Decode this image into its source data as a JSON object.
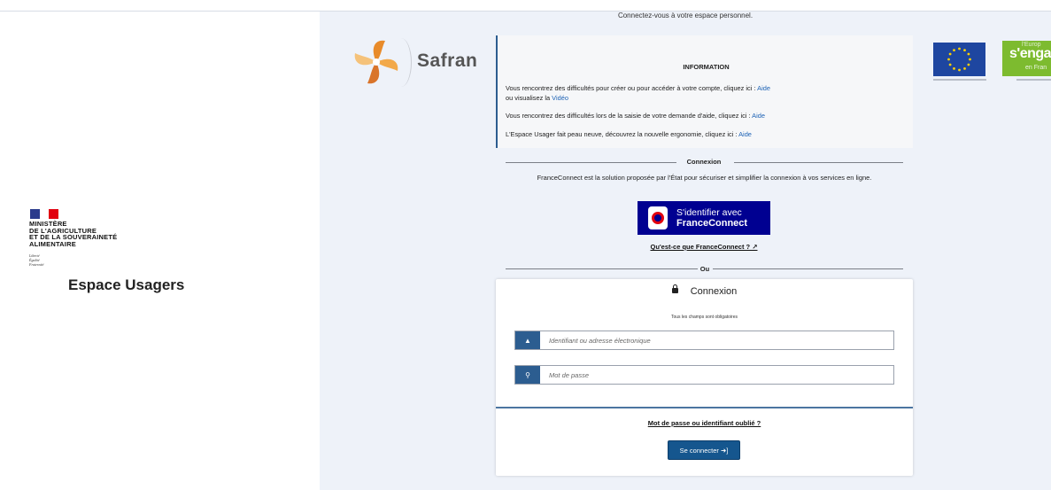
{
  "header": {
    "welcome": "Connectez-vous à votre espace personnel."
  },
  "sidebar": {
    "ministry_lines": [
      "MINISTÈRE",
      "DE L'AGRICULTURE",
      "ET DE LA SOUVERAINETÉ",
      "ALIMENTAIRE"
    ],
    "devise": [
      "Liberté",
      "Égalité",
      "Fraternité"
    ],
    "title": "Espace Usagers"
  },
  "brand": {
    "name": "Safran"
  },
  "partners": {
    "engage_1": "l'Europ",
    "engage_2": "s'engage",
    "engage_3": "en Fran"
  },
  "info": {
    "title": "INFORMATION",
    "line1_text": "Vous rencontrez des difficultés pour créer ou pour accéder à votre compte, cliquez ici : ",
    "line1_link": "Aide",
    "line1b_text": "ou visualisez la ",
    "line1b_link": "Vidéo",
    "line2_text": "Vous rencontrez des difficultés lors de la saisie de votre demande d'aide, cliquez ici : ",
    "line2_link": "Aide",
    "line3_text": "L'Espace Usager fait peau neuve, découvrez la nouvelle ergonomie, cliquez ici : ",
    "line3_link": "Aide"
  },
  "franceconnect": {
    "section_label": "Connexion",
    "description": "FranceConnect est la solution proposée par l'État pour sécuriser et simplifier la connexion à vos services en ligne.",
    "button_line1": "S'identifier avec",
    "button_line2": "FranceConnect",
    "what_link": "Qu'est-ce que FranceConnect ? ↗"
  },
  "or_label": "Ou",
  "login": {
    "title": "Connexion",
    "required_note": "Tous les champs sont obligatoires",
    "username_placeholder": "Identifiant ou adresse électronique",
    "password_placeholder": "Mot de passe",
    "forgot_link": "Mot de passe ou identifiant oublié ?",
    "submit_label": "Se connecter ➜]"
  },
  "colors": {
    "primary": "#2c5d90",
    "fc_blue": "#000091",
    "link": "#1d62b5",
    "panel_bg": "#eef2f9"
  }
}
